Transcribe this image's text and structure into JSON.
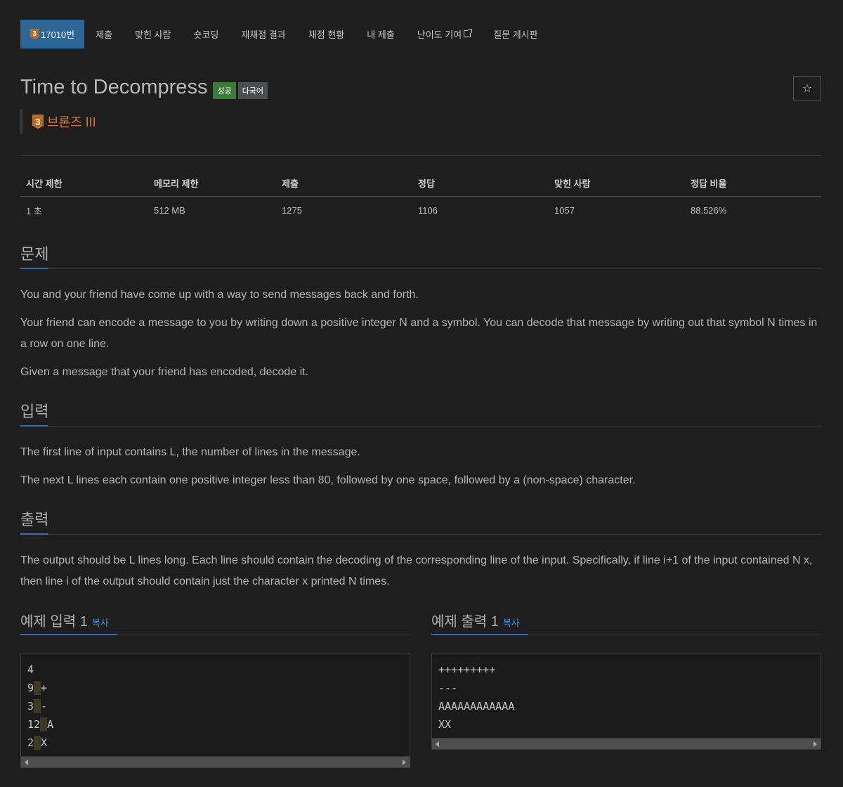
{
  "nav": {
    "problem_tier": "3",
    "items": [
      {
        "label": "17010번"
      },
      {
        "label": "제출"
      },
      {
        "label": "맞힌 사람"
      },
      {
        "label": "숏코딩"
      },
      {
        "label": "재채점 결과"
      },
      {
        "label": "채점 현황"
      },
      {
        "label": "내 제출"
      },
      {
        "label": "난이도 기여"
      },
      {
        "label": "질문 게시판"
      }
    ]
  },
  "problem": {
    "title": "Time to Decompress",
    "labels": {
      "success": "성공",
      "language": "다국어"
    },
    "star_icon": "☆",
    "tier_number": "3",
    "tier_name": "브론즈 III"
  },
  "stats": {
    "headers": [
      "시간 제한",
      "메모리 제한",
      "제출",
      "정답",
      "맞힌 사람",
      "정답 비율"
    ],
    "values": [
      "1 초",
      "512 MB",
      "1275",
      "1106",
      "1057",
      "88.526%"
    ]
  },
  "sections": {
    "description": {
      "heading": "문제",
      "paragraphs": [
        "You and your friend have come up with a way to send messages back and forth.",
        "Your friend can encode a message to you by writing down a positive integer N and a symbol. You can decode that message by writing out that symbol N times in a row on one line.",
        "Given a message that your friend has encoded, decode it."
      ]
    },
    "input": {
      "heading": "입력",
      "paragraphs": [
        "The first line of input contains L, the number of lines in the message.",
        "The next L lines each contain one positive integer less than 80, followed by one space, followed by a (non-space) character."
      ]
    },
    "output": {
      "heading": "출력",
      "paragraphs": [
        "The output should be L lines long. Each line should contain the decoding of the corresponding line of the input. Specifically, if line i+1 of the input contained N x, then line i of the output should contain just the character x printed N times."
      ]
    }
  },
  "examples": {
    "input": {
      "heading": "예제 입력 1",
      "copy": "복사",
      "lines": [
        [
          "4"
        ],
        [
          "9",
          "+"
        ],
        [
          "3",
          "-"
        ],
        [
          "12",
          "A"
        ],
        [
          "2",
          "X"
        ]
      ]
    },
    "output": {
      "heading": "예제 출력 1",
      "copy": "복사",
      "lines": [
        "+++++++++",
        "---",
        "AAAAAAAAAAAA",
        "XX"
      ]
    }
  }
}
